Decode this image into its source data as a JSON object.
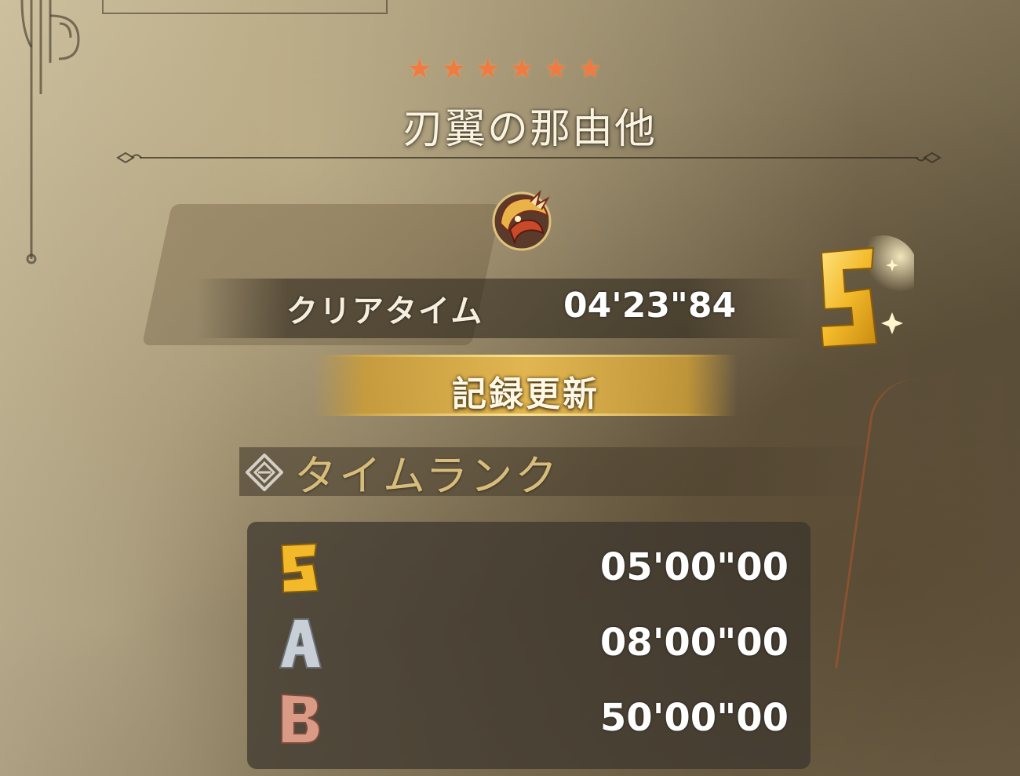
{
  "quest": {
    "stars": "★★★★★★",
    "title": "刃翼の那由他"
  },
  "result": {
    "clear_label": "クリアタイム",
    "clear_time": "04'23\"84",
    "rank": "S",
    "record_label": "記録更新"
  },
  "time_rank": {
    "title": "タイムランク",
    "rows": [
      {
        "rank": "S",
        "time": "05'00\"00",
        "color": "#f2b92a"
      },
      {
        "rank": "A",
        "time": "08'00\"00",
        "color": "#c9cfd6"
      },
      {
        "rank": "B",
        "time": "50'00\"00",
        "color": "#d99a86"
      }
    ]
  },
  "colors": {
    "star": "#f07a40",
    "gold": "#f2b92a",
    "section_title": "#d8bc7a"
  },
  "icons": {
    "monster": "winged-monster-icon",
    "section": "diamond-ornament-icon"
  }
}
